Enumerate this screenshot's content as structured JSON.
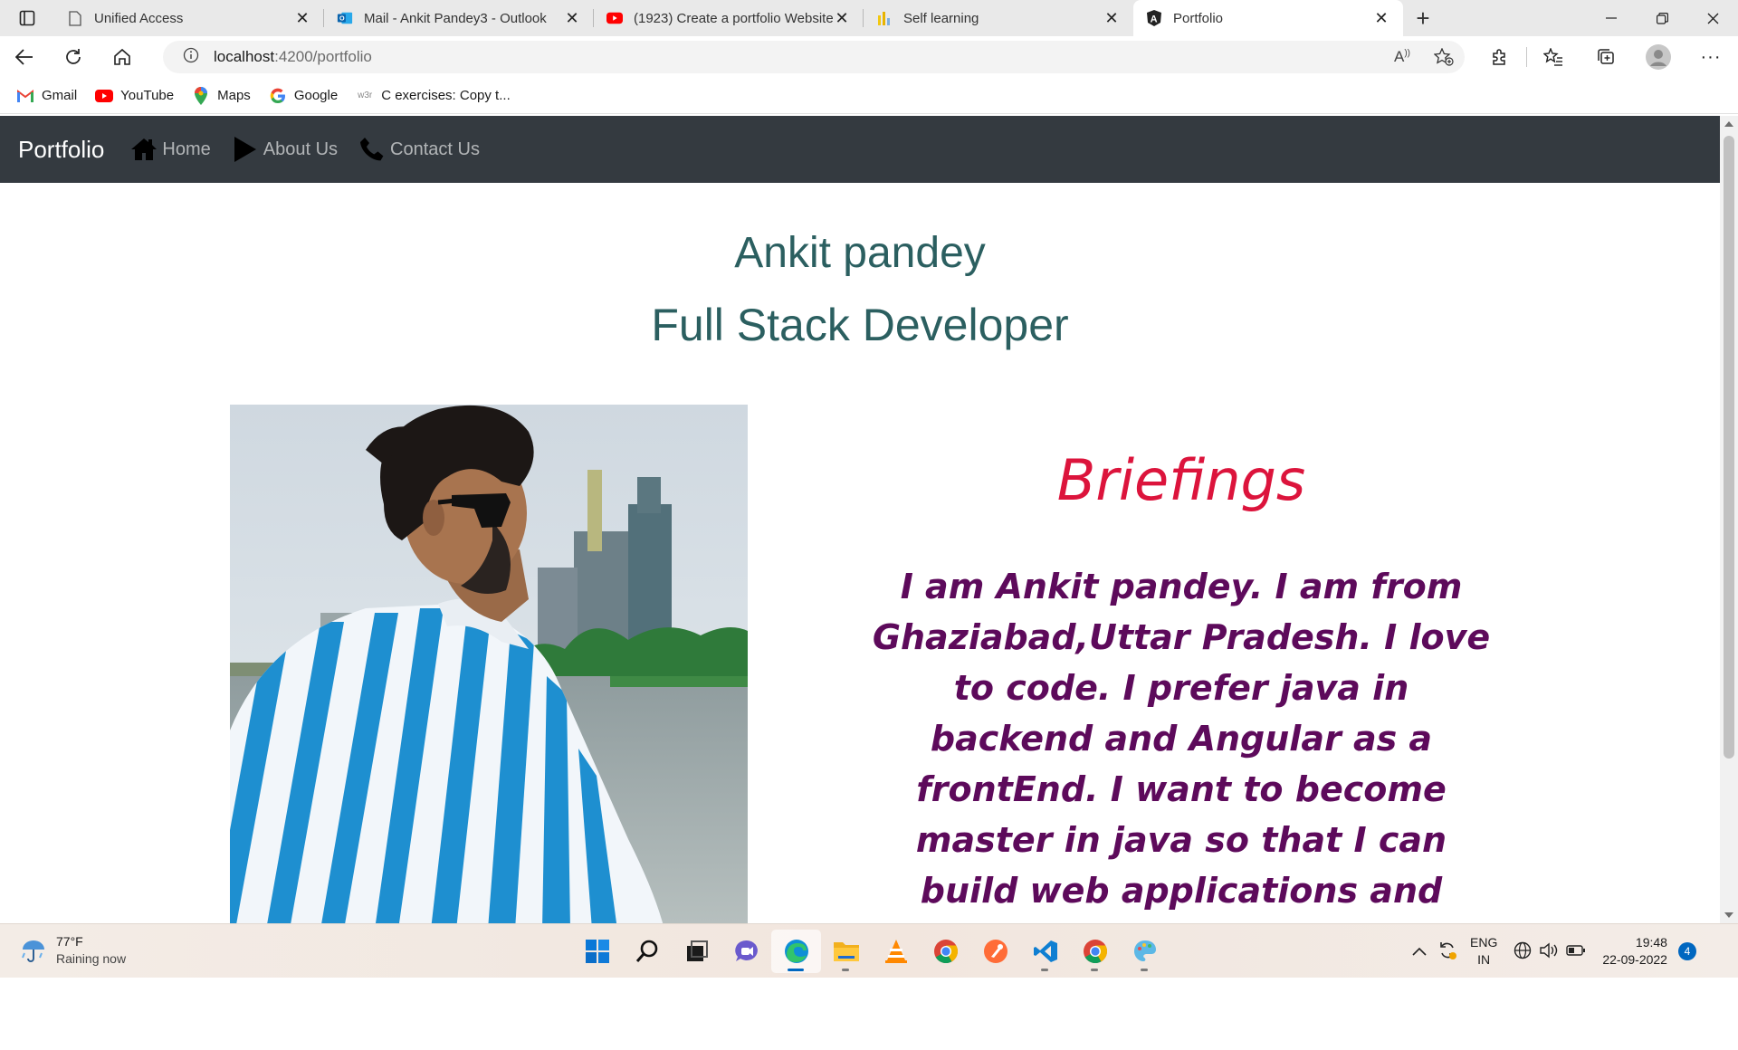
{
  "browser": {
    "tabs": [
      {
        "title": "Unified Access",
        "icon": "page-icon",
        "active": false
      },
      {
        "title": "Mail - Ankit Pandey3 - Outlook",
        "icon": "outlook-icon",
        "active": false
      },
      {
        "title": "(1923) Create a portfolio Website",
        "icon": "youtube-icon",
        "active": false
      },
      {
        "title": "Self learning",
        "icon": "chart-icon",
        "active": false
      },
      {
        "title": "Portfolio",
        "icon": "angular-icon",
        "active": true
      }
    ],
    "address": {
      "host": "localhost",
      "path": ":4200/portfolio"
    },
    "bookmarks": [
      {
        "label": "Gmail",
        "icon": "gmail-icon"
      },
      {
        "label": "YouTube",
        "icon": "youtube-icon"
      },
      {
        "label": "Maps",
        "icon": "maps-icon"
      },
      {
        "label": "Google",
        "icon": "google-icon"
      },
      {
        "label": "C exercises: Copy t...",
        "icon": "w3r-icon"
      }
    ]
  },
  "site": {
    "brand": "Portfolio",
    "nav": [
      {
        "label": "Home",
        "icon": "home-icon"
      },
      {
        "label": "About Us",
        "icon": "play-icon"
      },
      {
        "label": "Contact Us",
        "icon": "phone-icon"
      }
    ],
    "name": "Ankit pandey",
    "role": "Full Stack Developer",
    "briefings_title": "Briefings",
    "about": "I am Ankit pandey. I am from Ghaziabad,Uttar Pradesh. I love to code. I prefer java in backend and Angular as a frontEnd. I want to become master in java so that I can build web applications and mobile applications.",
    "colors": {
      "nav_bg": "#343a40",
      "heading": "#2b5f60",
      "briefings": "#dc143c",
      "about": "#5d0a5b"
    }
  },
  "taskbar": {
    "weather": {
      "temp": "77°F",
      "status": "Raining now"
    },
    "apps": [
      "windows-start-icon",
      "search-icon",
      "task-view-icon",
      "teams-chat-icon",
      "edge-icon",
      "file-explorer-icon",
      "vlc-icon",
      "chrome-icon",
      "postman-icon",
      "vscode-icon",
      "chrome-profile-icon",
      "paint-icon"
    ],
    "lang": {
      "line1": "ENG",
      "line2": "IN"
    },
    "time": "19:48",
    "date": "22-09-2022",
    "notifications": "4"
  }
}
